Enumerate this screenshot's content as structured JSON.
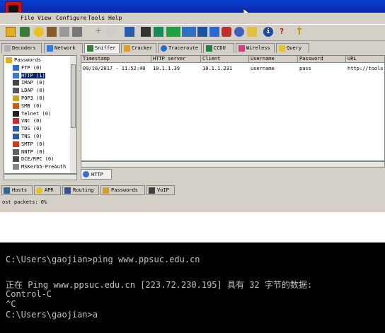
{
  "menu": [
    "File",
    "View",
    "Configure",
    "Tools",
    "Help"
  ],
  "main_tabs": [
    "Decoders",
    "Network",
    "Sniffer",
    "Cracker",
    "Traceroute",
    "CCDU",
    "Wireless",
    "Query"
  ],
  "tree": [
    {
      "label": "Passwords",
      "selected": false,
      "indent": 0
    },
    {
      "label": "FTP  (0)",
      "selected": false,
      "indent": 1
    },
    {
      "label": "HTTP  (1)",
      "selected": true,
      "indent": 1
    },
    {
      "label": "IMAP  (0)",
      "selected": false,
      "indent": 1
    },
    {
      "label": "LDAP  (0)",
      "selected": false,
      "indent": 1
    },
    {
      "label": "POP3  (0)",
      "selected": false,
      "indent": 1
    },
    {
      "label": "SMB  (0)",
      "selected": false,
      "indent": 1
    },
    {
      "label": "Telnet  (0)",
      "selected": false,
      "indent": 1
    },
    {
      "label": "VNC  (0)",
      "selected": false,
      "indent": 1
    },
    {
      "label": "TDS  (0)",
      "selected": false,
      "indent": 1
    },
    {
      "label": "TNS  (0)",
      "selected": false,
      "indent": 1
    },
    {
      "label": "SMTP  (0)",
      "selected": false,
      "indent": 1
    },
    {
      "label": "NNTP  (0)",
      "selected": false,
      "indent": 1
    },
    {
      "label": "DCE/RPC  (0)",
      "selected": false,
      "indent": 1
    },
    {
      "label": "MSKerb5-PreAuth",
      "selected": false,
      "indent": 1
    }
  ],
  "grid_headers": [
    "Timestamp",
    "HTTP server",
    "Client",
    "Username",
    "Password",
    "URL"
  ],
  "grid_rows": [
    [
      "09/10/2017 - 11:52:40",
      "10.1.1.39",
      "10.1.1.231",
      "username",
      "pass",
      "http://tools."
    ]
  ],
  "subtab_label": "HTTP",
  "bottom_tabs": [
    "Hosts",
    "APR",
    "Routing",
    "Passwords",
    "VoIP"
  ],
  "status_text": "ost packets:   0%",
  "terminal_lines": [
    "C:\\Users\\gaojian>ping www.ppsuc.edu.cn",
    "",
    "正在 Ping www.ppsuc.edu.cn [223.72.230.195] 具有 32 字节的数据:",
    "Control-C",
    "^C",
    "C:\\Users\\gaojian>a"
  ],
  "colors": {
    "titlebar": "#0a3fd0",
    "selection": "#0a246a",
    "terminal_bg": "#000000",
    "terminal_fg": "#c0c0c0"
  }
}
